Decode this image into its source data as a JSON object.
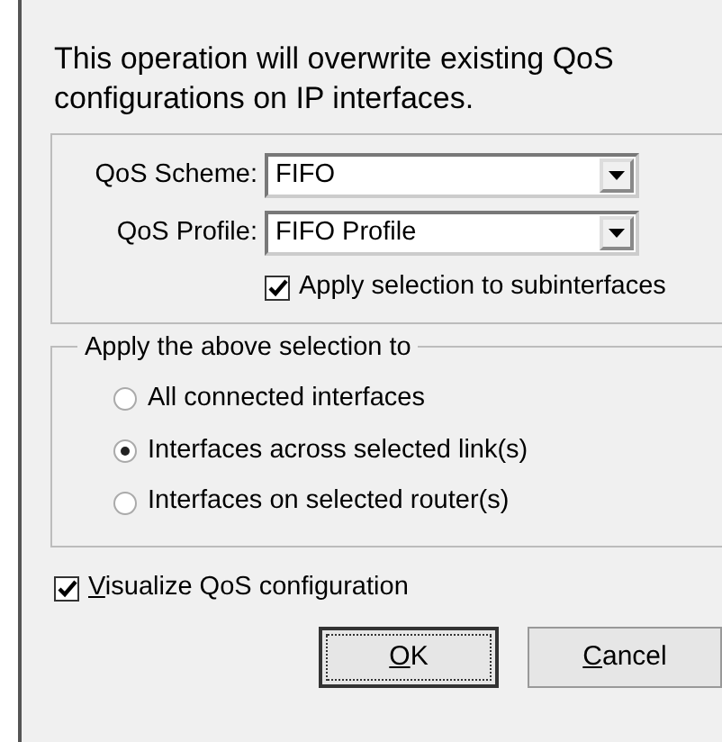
{
  "message": "This operation will overwrite existing QoS configurations on IP interfaces.",
  "fields": [
    {
      "label": "QoS Scheme:",
      "value": "FIFO"
    },
    {
      "label": "QoS Profile:",
      "value": "FIFO Profile"
    }
  ],
  "subinterfaces": {
    "label": "Apply selection to subinterfaces",
    "checked": true
  },
  "apply_group": {
    "title": "Apply the above selection to",
    "options": [
      {
        "label": "All connected interfaces",
        "selected": false
      },
      {
        "label": "Interfaces across selected link(s)",
        "selected": true
      },
      {
        "label": "Interfaces on selected router(s)",
        "selected": false
      }
    ]
  },
  "visualize": {
    "label": "Visualize QoS configuration",
    "checked": true,
    "mnemonic": true
  },
  "buttons": [
    {
      "label": "OK",
      "default": true,
      "mnemonic": true
    },
    {
      "label": "Cancel",
      "default": false,
      "mnemonic": true
    }
  ]
}
